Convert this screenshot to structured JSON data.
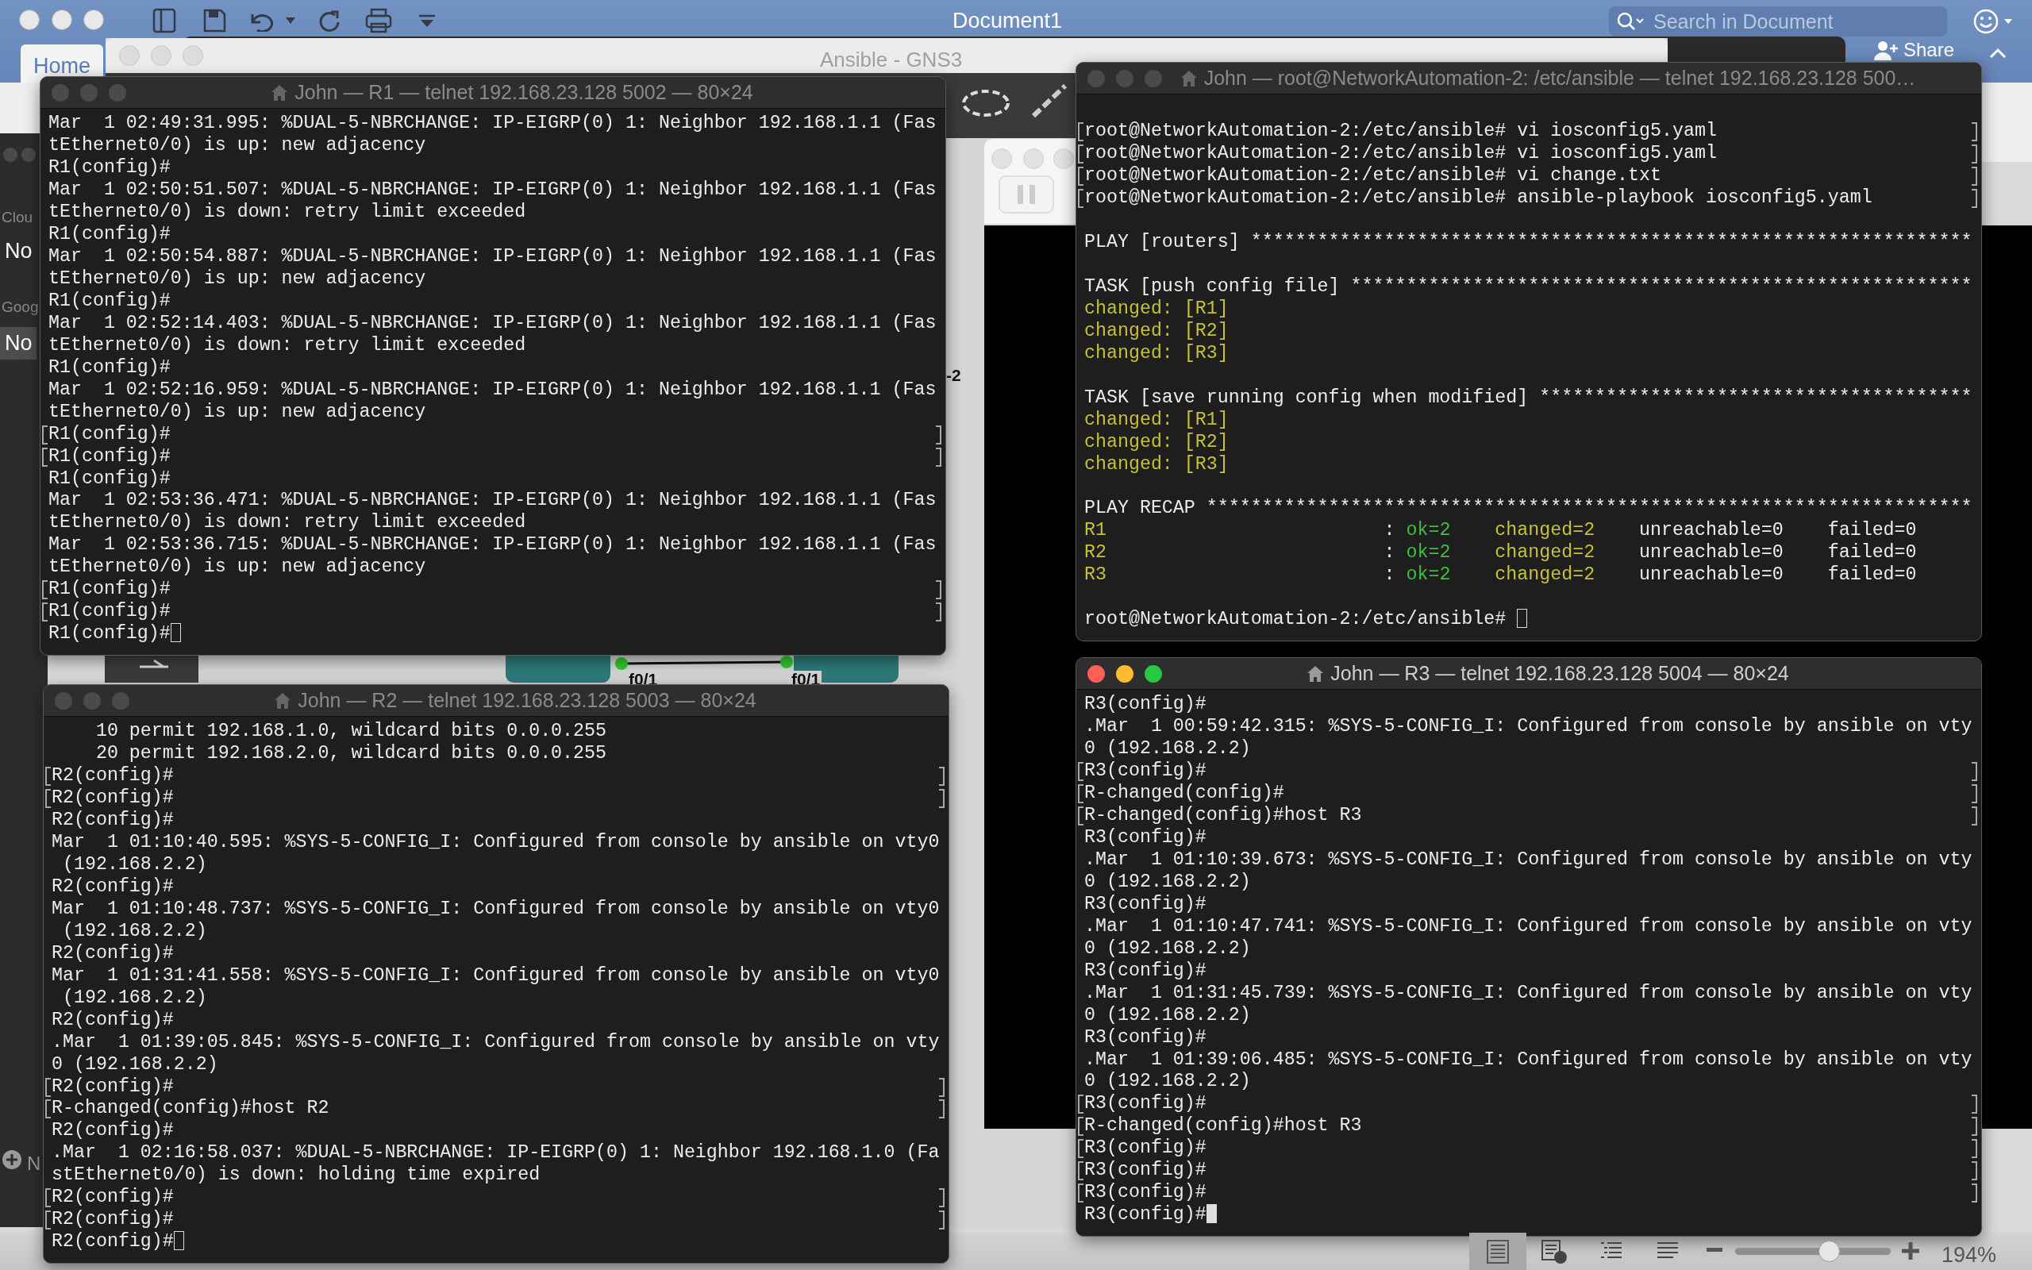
{
  "word": {
    "title": "Document1",
    "tab": "Home",
    "search": {
      "placeholder": "Search in Document"
    },
    "share": "Share",
    "views": [
      {
        "kind": "print",
        "selected": true
      },
      {
        "kind": "web",
        "selected": false
      },
      {
        "kind": "outline",
        "selected": false
      },
      {
        "kind": "draft",
        "selected": false
      }
    ],
    "zoom": {
      "level": 0.6,
      "reading": "194%"
    }
  },
  "gns3": {
    "title": "Ansible - GNS3",
    "panel_items": [
      {
        "text": "Clou",
        "kind": "heading"
      },
      {
        "text": "No",
        "kind": "item",
        "selected": false
      },
      {
        "text": "Goog",
        "kind": "heading"
      },
      {
        "text": "No",
        "kind": "item",
        "selected": true
      }
    ],
    "add_label": "N",
    "node_label": "-2",
    "port_labels": [
      "f0/1",
      "f0/1"
    ]
  },
  "terminals": [
    {
      "title": "John — R1 — telnet 192.168.23.128 5002 — 80×24",
      "active": false,
      "lines": [
        {
          "text": "Mar  1 02:49:31.995: %DUAL-5-NBRCHANGE: IP-EIGRP(0) 1: Neighbor 192.168.1.1 (Fas",
          "marked": false
        },
        {
          "text": "tEthernet0/0) is up: new adjacency",
          "marked": false
        },
        {
          "text": "R1(config)#",
          "marked": false
        },
        {
          "text": "Mar  1 02:50:51.507: %DUAL-5-NBRCHANGE: IP-EIGRP(0) 1: Neighbor 192.168.1.1 (Fas",
          "marked": false
        },
        {
          "text": "tEthernet0/0) is down: retry limit exceeded",
          "marked": false
        },
        {
          "text": "R1(config)#",
          "marked": false
        },
        {
          "text": "Mar  1 02:50:54.887: %DUAL-5-NBRCHANGE: IP-EIGRP(0) 1: Neighbor 192.168.1.1 (Fas",
          "marked": false
        },
        {
          "text": "tEthernet0/0) is up: new adjacency",
          "marked": false
        },
        {
          "text": "R1(config)#",
          "marked": false
        },
        {
          "text": "Mar  1 02:52:14.403: %DUAL-5-NBRCHANGE: IP-EIGRP(0) 1: Neighbor 192.168.1.1 (Fas",
          "marked": false
        },
        {
          "text": "tEthernet0/0) is down: retry limit exceeded",
          "marked": false
        },
        {
          "text": "R1(config)#",
          "marked": false
        },
        {
          "text": "Mar  1 02:52:16.959: %DUAL-5-NBRCHANGE: IP-EIGRP(0) 1: Neighbor 192.168.1.1 (Fas",
          "marked": false
        },
        {
          "text": "tEthernet0/0) is up: new adjacency",
          "marked": false
        },
        {
          "text": "R1(config)#",
          "marked": true
        },
        {
          "text": "R1(config)#",
          "marked": true
        },
        {
          "text": "R1(config)#",
          "marked": false
        },
        {
          "text": "Mar  1 02:53:36.471: %DUAL-5-NBRCHANGE: IP-EIGRP(0) 1: Neighbor 192.168.1.1 (Fas",
          "marked": false
        },
        {
          "text": "tEthernet0/0) is down: retry limit exceeded",
          "marked": false
        },
        {
          "text": "Mar  1 02:53:36.715: %DUAL-5-NBRCHANGE: IP-EIGRP(0) 1: Neighbor 192.168.1.1 (Fas",
          "marked": false
        },
        {
          "text": "tEthernet0/0) is up: new adjacency",
          "marked": false
        },
        {
          "text": "R1(config)#",
          "marked": true
        },
        {
          "text": "R1(config)#",
          "marked": true
        },
        {
          "text": "R1(config)#",
          "marked": false,
          "cursor": true
        }
      ]
    },
    {
      "title": "John — root@NetworkAutomation-2: /etc/ansible — telnet 192.168.23.128 500…",
      "active": false,
      "lines": [
        {
          "kind": "blank"
        },
        {
          "kind": "text",
          "text": "root@NetworkAutomation-2:/etc/ansible# vi iosconfig5.yaml",
          "marked": true
        },
        {
          "kind": "text",
          "text": "root@NetworkAutomation-2:/etc/ansible# vi iosconfig5.yaml",
          "marked": true
        },
        {
          "kind": "text",
          "text": "root@NetworkAutomation-2:/etc/ansible# vi change.txt",
          "marked": true
        },
        {
          "kind": "text",
          "text": "root@NetworkAutomation-2:/etc/ansible# ansible-playbook iosconfig5.yaml",
          "marked": true
        },
        {
          "kind": "blank"
        },
        {
          "kind": "text",
          "text": "PLAY [routers] *****************************************************************",
          "marked": false
        },
        {
          "kind": "blank"
        },
        {
          "kind": "text",
          "text": "TASK [push config file] ********************************************************",
          "marked": false
        },
        {
          "kind": "segments",
          "segments": [
            {
              "text": "changed: [R1]",
              "kind": "changed"
            }
          ],
          "marked": false
        },
        {
          "kind": "segments",
          "segments": [
            {
              "text": "changed: [R2]",
              "kind": "changed"
            }
          ],
          "marked": false
        },
        {
          "kind": "segments",
          "segments": [
            {
              "text": "changed: [R3]",
              "kind": "changed"
            }
          ],
          "marked": false
        },
        {
          "kind": "blank"
        },
        {
          "kind": "text",
          "text": "TASK [save running config when modified] ***************************************",
          "marked": false
        },
        {
          "kind": "segments",
          "segments": [
            {
              "text": "changed: [R1]",
              "kind": "changed"
            }
          ],
          "marked": false
        },
        {
          "kind": "segments",
          "segments": [
            {
              "text": "changed: [R2]",
              "kind": "changed"
            }
          ],
          "marked": false
        },
        {
          "kind": "segments",
          "segments": [
            {
              "text": "changed: [R3]",
              "kind": "changed"
            }
          ],
          "marked": false
        },
        {
          "kind": "blank"
        },
        {
          "kind": "text",
          "text": "PLAY RECAP *********************************************************************",
          "marked": false
        },
        {
          "kind": "segments",
          "segments": [
            {
              "text": "R1",
              "kind": "changed"
            },
            {
              "text": "                         : ",
              "kind": "plain"
            },
            {
              "text": "ok=2",
              "kind": "ok"
            },
            {
              "text": "    changed=2",
              "kind": "changed"
            },
            {
              "text": "    unreachable=0    failed=0",
              "kind": "plain"
            }
          ],
          "marked": false
        },
        {
          "kind": "segments",
          "segments": [
            {
              "text": "R2",
              "kind": "changed"
            },
            {
              "text": "                         : ",
              "kind": "plain"
            },
            {
              "text": "ok=2",
              "kind": "ok"
            },
            {
              "text": "    changed=2",
              "kind": "changed"
            },
            {
              "text": "    unreachable=0    failed=0",
              "kind": "plain"
            }
          ],
          "marked": false
        },
        {
          "kind": "segments",
          "segments": [
            {
              "text": "R3",
              "kind": "changed"
            },
            {
              "text": "                         : ",
              "kind": "plain"
            },
            {
              "text": "ok=2",
              "kind": "ok"
            },
            {
              "text": "    changed=2",
              "kind": "changed"
            },
            {
              "text": "    unreachable=0    failed=0",
              "kind": "plain"
            }
          ],
          "marked": false
        },
        {
          "kind": "blank"
        },
        {
          "kind": "text",
          "text": "root@NetworkAutomation-2:/etc/ansible# ",
          "marked": false,
          "cursor": true
        }
      ]
    },
    {
      "title": "John — R2 — telnet 192.168.23.128 5003 — 80×24",
      "active": false,
      "lines": [
        {
          "text": "    10 permit 192.168.1.0, wildcard bits 0.0.0.255",
          "marked": false
        },
        {
          "text": "    20 permit 192.168.2.0, wildcard bits 0.0.0.255",
          "marked": false
        },
        {
          "text": "R2(config)#",
          "marked": true
        },
        {
          "text": "R2(config)#",
          "marked": true
        },
        {
          "text": "R2(config)#",
          "marked": false
        },
        {
          "text": "Mar  1 01:10:40.595: %SYS-5-CONFIG_I: Configured from console by ansible on vty0",
          "marked": false
        },
        {
          "text": " (192.168.2.2)",
          "marked": false
        },
        {
          "text": "R2(config)#",
          "marked": false
        },
        {
          "text": "Mar  1 01:10:48.737: %SYS-5-CONFIG_I: Configured from console by ansible on vty0",
          "marked": false
        },
        {
          "text": " (192.168.2.2)",
          "marked": false
        },
        {
          "text": "R2(config)#",
          "marked": false
        },
        {
          "text": "Mar  1 01:31:41.558: %SYS-5-CONFIG_I: Configured from console by ansible on vty0",
          "marked": false
        },
        {
          "text": " (192.168.2.2)",
          "marked": false
        },
        {
          "text": "R2(config)#",
          "marked": false
        },
        {
          "text": ".Mar  1 01:39:05.845: %SYS-5-CONFIG_I: Configured from console by ansible on vty",
          "marked": false
        },
        {
          "text": "0 (192.168.2.2)",
          "marked": false
        },
        {
          "text": "R2(config)#",
          "marked": true
        },
        {
          "text": "R-changed(config)#host R2",
          "marked": true
        },
        {
          "text": "R2(config)#",
          "marked": false
        },
        {
          "text": ".Mar  1 02:16:58.037: %DUAL-5-NBRCHANGE: IP-EIGRP(0) 1: Neighbor 192.168.1.0 (Fa",
          "marked": false
        },
        {
          "text": "stEthernet0/0) is down: holding time expired",
          "marked": false
        },
        {
          "text": "R2(config)#",
          "marked": true
        },
        {
          "text": "R2(config)#",
          "marked": true
        },
        {
          "text": "R2(config)#",
          "marked": false,
          "cursor": true
        }
      ]
    },
    {
      "title": "John — R3 — telnet 192.168.23.128 5004 — 80×24",
      "active": true,
      "lines": [
        {
          "text": "R3(config)#",
          "marked": false
        },
        {
          "text": ".Mar  1 00:59:42.315: %SYS-5-CONFIG_I: Configured from console by ansible on vty",
          "marked": false
        },
        {
          "text": "0 (192.168.2.2)",
          "marked": false
        },
        {
          "text": "R3(config)#",
          "marked": true
        },
        {
          "text": "R-changed(config)#",
          "marked": true
        },
        {
          "text": "R-changed(config)#host R3",
          "marked": true
        },
        {
          "text": "R3(config)#",
          "marked": false
        },
        {
          "text": ".Mar  1 01:10:39.673: %SYS-5-CONFIG_I: Configured from console by ansible on vty",
          "marked": false
        },
        {
          "text": "0 (192.168.2.2)",
          "marked": false
        },
        {
          "text": "R3(config)#",
          "marked": false
        },
        {
          "text": ".Mar  1 01:10:47.741: %SYS-5-CONFIG_I: Configured from console by ansible on vty",
          "marked": false
        },
        {
          "text": "0 (192.168.2.2)",
          "marked": false
        },
        {
          "text": "R3(config)#",
          "marked": false
        },
        {
          "text": ".Mar  1 01:31:45.739: %SYS-5-CONFIG_I: Configured from console by ansible on vty",
          "marked": false
        },
        {
          "text": "0 (192.168.2.2)",
          "marked": false
        },
        {
          "text": "R3(config)#",
          "marked": false
        },
        {
          "text": ".Mar  1 01:39:06.485: %SYS-5-CONFIG_I: Configured from console by ansible on vty",
          "marked": false
        },
        {
          "text": "0 (192.168.2.2)",
          "marked": false
        },
        {
          "text": "R3(config)#",
          "marked": true
        },
        {
          "text": "R-changed(config)#host R3",
          "marked": true
        },
        {
          "text": "R3(config)#",
          "marked": true
        },
        {
          "text": "R3(config)#",
          "marked": true
        },
        {
          "text": "R3(config)#",
          "marked": true
        },
        {
          "text": "R3(config)#",
          "marked": false,
          "cursor": true
        }
      ]
    }
  ]
}
